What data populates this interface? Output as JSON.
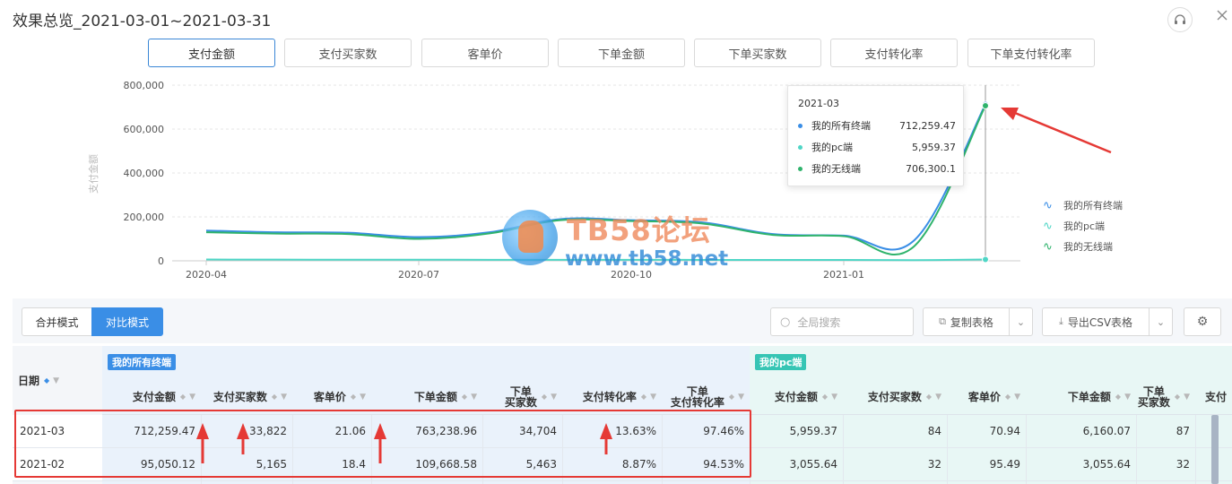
{
  "header": {
    "title": "效果总览_2021-03-01~2021-03-31"
  },
  "metric_tabs": [
    {
      "label": "支付金额",
      "active": true
    },
    {
      "label": "支付买家数",
      "active": false
    },
    {
      "label": "客单价",
      "active": false
    },
    {
      "label": "下单金额",
      "active": false
    },
    {
      "label": "下单买家数",
      "active": false
    },
    {
      "label": "支付转化率",
      "active": false
    },
    {
      "label": "下单支付转化率",
      "active": false
    }
  ],
  "chart_data": {
    "type": "line",
    "ylabel": "支付金额",
    "ylim": [
      0,
      800000
    ],
    "y_ticks": [
      "0",
      "200,000",
      "400,000",
      "600,000",
      "800,000"
    ],
    "x_ticks": [
      "2020-04",
      "2020-07",
      "2020-10",
      "2021-01"
    ],
    "x": [
      "2020-04",
      "2020-05",
      "2020-06",
      "2020-07",
      "2020-08",
      "2020-09",
      "2020-10",
      "2020-11",
      "2020-12",
      "2021-01",
      "2021-02",
      "2021-03"
    ],
    "series": [
      {
        "name": "我的所有终端",
        "color": "#3a8ee6",
        "values": [
          138000,
          130000,
          128000,
          108000,
          130000,
          190000,
          185000,
          175000,
          122000,
          115000,
          95050.12,
          712259.47
        ]
      },
      {
        "name": "我的pc端",
        "color": "#4fd6c6",
        "values": [
          6000,
          5500,
          5200,
          5000,
          4800,
          4600,
          4500,
          4300,
          4100,
          4000,
          3055.64,
          5959.37
        ]
      },
      {
        "name": "我的无线端",
        "color": "#2fb36c",
        "values": [
          130000,
          124000,
          122000,
          100000,
          125000,
          185000,
          181000,
          170000,
          118000,
          112000,
          68000,
          706300.1
        ]
      }
    ],
    "legend_position": "right",
    "grid": true
  },
  "tooltip": {
    "title": "2021-03",
    "rows": [
      {
        "name": "我的所有终端",
        "value": "712,259.47",
        "color": "#3a8ee6"
      },
      {
        "name": "我的pc端",
        "value": "5,959.37",
        "color": "#4fd6c6"
      },
      {
        "name": "我的无线端",
        "value": "706,300.1",
        "color": "#2fb36c"
      }
    ]
  },
  "watermark": {
    "main": "TB58论坛",
    "url": "www.tb58.net"
  },
  "toolbar": {
    "merge_mode": "合并模式",
    "compare_mode": "对比模式",
    "search_placeholder": "全局搜索",
    "copy_table": "复制表格",
    "export_csv": "导出CSV表格"
  },
  "table": {
    "date_header": "日期",
    "group_all": "我的所有终端",
    "group_pc": "我的pc端",
    "columns_all": [
      {
        "line1": "支付金额",
        "line2": ""
      },
      {
        "line1": "支付买家数",
        "line2": ""
      },
      {
        "line1": "客单价",
        "line2": ""
      },
      {
        "line1": "下单金额",
        "line2": ""
      },
      {
        "line1": "下单",
        "line2": "买家数"
      },
      {
        "line1": "支付转化率",
        "line2": ""
      },
      {
        "line1": "下单",
        "line2": "支付转化率"
      }
    ],
    "columns_pc": [
      {
        "line1": "支付金额",
        "line2": ""
      },
      {
        "line1": "支付买家数",
        "line2": ""
      },
      {
        "line1": "客单价",
        "line2": ""
      },
      {
        "line1": "下单金额",
        "line2": ""
      },
      {
        "line1": "下单",
        "line2": "买家数"
      },
      {
        "line1": "支付",
        "line2": ""
      }
    ],
    "rows": [
      {
        "date": "2021-03",
        "all": [
          "712,259.47",
          "33,822",
          "21.06",
          "763,238.96",
          "34,704",
          "13.63%",
          "97.46%"
        ],
        "pc": [
          "5,959.37",
          "84",
          "70.94",
          "6,160.07",
          "87"
        ]
      },
      {
        "date": "2021-02",
        "all": [
          "95,050.12",
          "5,165",
          "18.4",
          "109,668.58",
          "5,463",
          "8.87%",
          "94.53%"
        ],
        "pc": [
          "3,055.64",
          "32",
          "95.49",
          "3,055.64",
          "32"
        ]
      }
    ]
  }
}
